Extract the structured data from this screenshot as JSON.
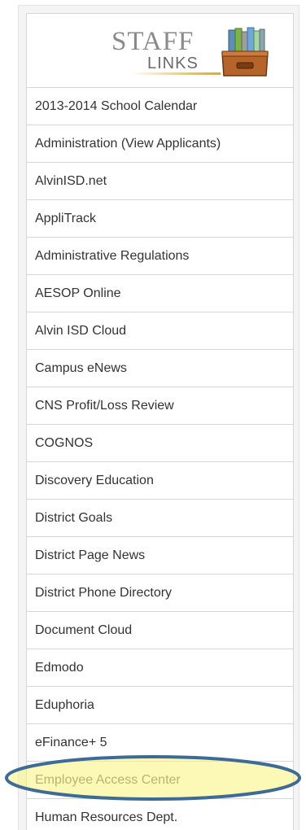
{
  "header": {
    "logo_staff": "STAFF",
    "logo_links": "LINKS"
  },
  "links": [
    "2013-2014 School Calendar",
    "Administration (View Applicants)",
    "AlvinISD.net",
    "AppliTrack",
    "Administrative Regulations",
    "AESOP Online",
    "Alvin ISD Cloud",
    "Campus eNews",
    "CNS Profit/Loss Review",
    "COGNOS",
    "Discovery Education",
    "District Goals",
    "District Page News",
    "District Phone Directory",
    "Document Cloud",
    "Edmodo",
    "Eduphoria",
    "eFinance+ 5",
    "Employee Access Center",
    "Human Resources Dept."
  ],
  "highlighted_link": "Employee Access Center",
  "colors": {
    "highlight_fill": "#f7f49a",
    "highlight_stroke": "#3d6a96",
    "logo_accent": "#f2c23a"
  },
  "icons": {
    "logo": "file-box-binders-icon"
  }
}
